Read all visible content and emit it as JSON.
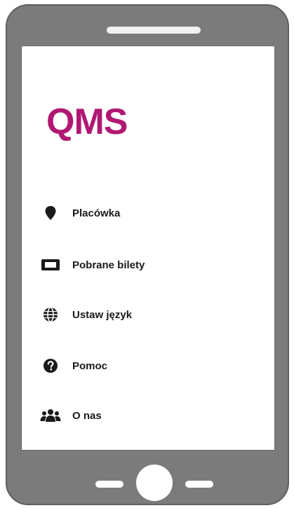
{
  "app": {
    "logo_text": "QMS",
    "brand_color": "#b01872"
  },
  "menu": {
    "items": [
      {
        "label": "Placówka",
        "icon": "map-pin-icon"
      },
      {
        "label": "Pobrane bilety",
        "icon": "ticket-icon"
      },
      {
        "label": "Ustaw język",
        "icon": "globe-icon"
      },
      {
        "label": "Pomoc",
        "icon": "help-circle-icon"
      },
      {
        "label": "O nas",
        "icon": "users-icon"
      }
    ]
  },
  "device": {
    "frame_color": "#7b7b7b"
  }
}
